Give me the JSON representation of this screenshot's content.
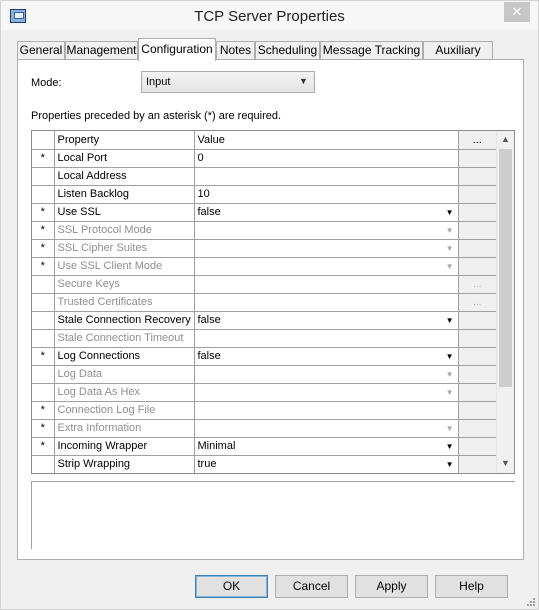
{
  "window": {
    "title": "TCP Server Properties",
    "close_glyph": "✕"
  },
  "tabs": [
    {
      "label": "General",
      "active": false
    },
    {
      "label": "Management",
      "active": false
    },
    {
      "label": "Configuration",
      "active": true
    },
    {
      "label": "Notes",
      "active": false
    },
    {
      "label": "Scheduling",
      "active": false
    },
    {
      "label": "Message Tracking",
      "active": false
    },
    {
      "label": "Auxiliary Files",
      "active": false
    }
  ],
  "mode": {
    "label": "Mode:",
    "value": "Input",
    "chevron": "▼"
  },
  "required_note": "Properties preceded by an asterisk (*) are required.",
  "grid": {
    "headers": {
      "property": "Property",
      "value": "Value",
      "button": "..."
    },
    "rows": [
      {
        "req": "*",
        "property": "Local Port",
        "value": "0",
        "enabled": true,
        "dropdown": false,
        "ellipsis": false
      },
      {
        "req": "",
        "property": "Local Address",
        "value": "",
        "enabled": true,
        "dropdown": false,
        "ellipsis": false
      },
      {
        "req": "",
        "property": "Listen Backlog",
        "value": "10",
        "enabled": true,
        "dropdown": false,
        "ellipsis": false
      },
      {
        "req": "*",
        "property": "Use SSL",
        "value": "false",
        "enabled": true,
        "dropdown": true,
        "ellipsis": false
      },
      {
        "req": "*",
        "property": "SSL Protocol Mode",
        "value": "",
        "enabled": false,
        "dropdown": true,
        "ellipsis": false
      },
      {
        "req": "*",
        "property": "SSL Cipher Suites",
        "value": "",
        "enabled": false,
        "dropdown": true,
        "ellipsis": false
      },
      {
        "req": "*",
        "property": "Use SSL Client Mode",
        "value": "",
        "enabled": false,
        "dropdown": true,
        "ellipsis": false
      },
      {
        "req": "",
        "property": "Secure Keys",
        "value": "",
        "enabled": false,
        "dropdown": false,
        "ellipsis": true
      },
      {
        "req": "",
        "property": "Trusted Certificates",
        "value": "",
        "enabled": false,
        "dropdown": false,
        "ellipsis": true
      },
      {
        "req": "",
        "property": "Stale Connection Recovery",
        "value": "false",
        "enabled": true,
        "dropdown": true,
        "ellipsis": false
      },
      {
        "req": "",
        "property": "Stale Connection Timeout",
        "value": "",
        "enabled": false,
        "dropdown": false,
        "ellipsis": false
      },
      {
        "req": "*",
        "property": "Log Connections",
        "value": "false",
        "enabled": true,
        "dropdown": true,
        "ellipsis": false
      },
      {
        "req": "",
        "property": "Log Data",
        "value": "",
        "enabled": false,
        "dropdown": true,
        "ellipsis": false
      },
      {
        "req": "",
        "property": "Log Data As Hex",
        "value": "",
        "enabled": false,
        "dropdown": true,
        "ellipsis": false
      },
      {
        "req": "*",
        "property": "Connection Log File",
        "value": "",
        "enabled": false,
        "dropdown": false,
        "ellipsis": false
      },
      {
        "req": "*",
        "property": "Extra Information",
        "value": "",
        "enabled": false,
        "dropdown": true,
        "ellipsis": false
      },
      {
        "req": "*",
        "property": "Incoming Wrapper",
        "value": "Minimal",
        "enabled": true,
        "dropdown": true,
        "ellipsis": false
      },
      {
        "req": "",
        "property": "Strip Wrapping",
        "value": "true",
        "enabled": true,
        "dropdown": true,
        "ellipsis": false
      }
    ],
    "dropdown_glyph": "▼",
    "ellipsis_glyph": "...",
    "scroll_up_glyph": "▲",
    "scroll_down_glyph": "▼"
  },
  "buttons": {
    "ok": "OK",
    "cancel": "Cancel",
    "apply": "Apply",
    "help": "Help"
  },
  "icons": {
    "app": "tcp-server-icon",
    "grip": "resize-grip-icon"
  }
}
